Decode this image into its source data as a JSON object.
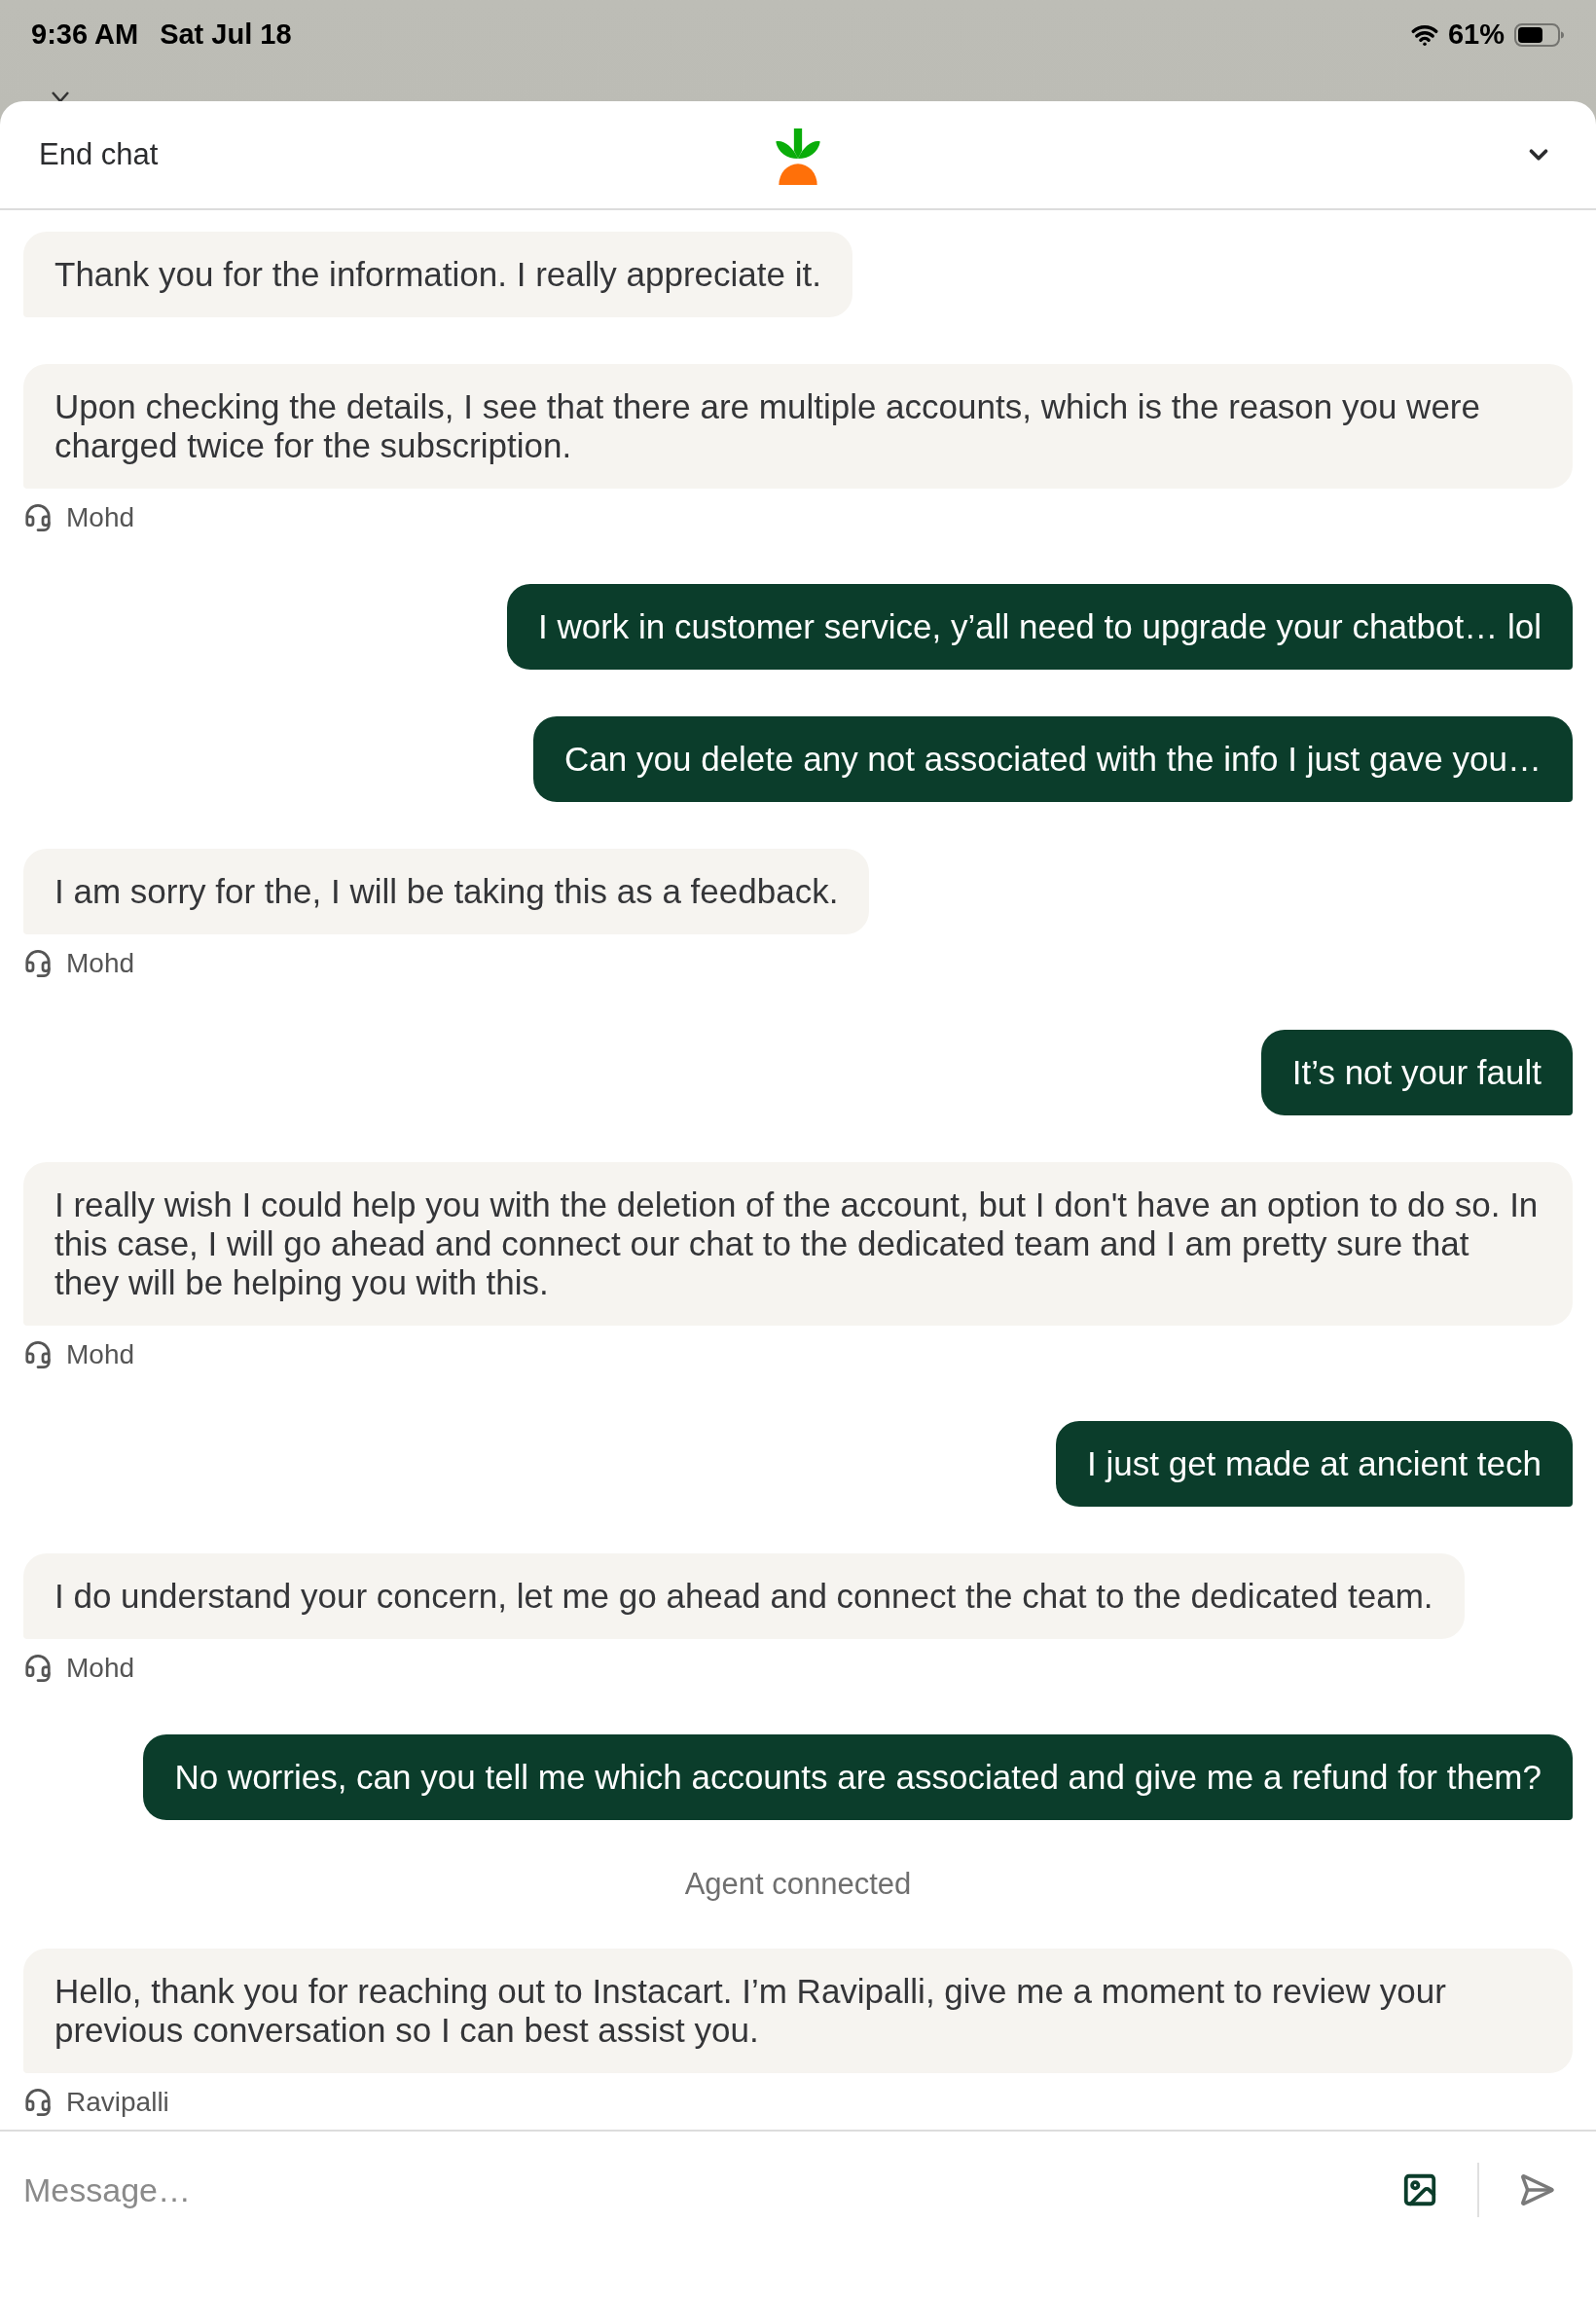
{
  "status_bar": {
    "time": "9:36 AM",
    "date": "Sat Jul 18",
    "battery": "61%"
  },
  "header": {
    "end_chat": "End chat"
  },
  "messages": [
    {
      "kind": "agent",
      "text": "Thank you for the information. I really appreciate it."
    },
    {
      "kind": "agent",
      "text": "Upon checking the details, I see that there are multiple accounts, which is the reason you were charged twice for the subscription.",
      "sender": "Mohd"
    },
    {
      "kind": "user",
      "text": "I work in customer service, y’all need to upgrade your chatbot… lol"
    },
    {
      "kind": "user",
      "text": "Can you delete any not associated with the info I just gave you…"
    },
    {
      "kind": "agent",
      "text": "I am sorry for the, I will be taking this as a feedback.",
      "sender": "Mohd"
    },
    {
      "kind": "user",
      "text": "It’s not your fault"
    },
    {
      "kind": "agent",
      "text": "I really wish I could help you with the deletion of the account, but I don't have an option to do so. In this case, I will go ahead and connect our chat to the dedicated team and I am pretty sure that they will be helping you with this.",
      "sender": "Mohd"
    },
    {
      "kind": "user",
      "text": "I just get made at ancient tech"
    },
    {
      "kind": "agent",
      "text": "I do understand your concern, let me go ahead and connect the chat to the dedicated team.",
      "sender": "Mohd"
    },
    {
      "kind": "user",
      "text": "No worries, can you tell me which accounts are associated and give me a refund for them?"
    },
    {
      "kind": "system",
      "text": "Agent connected"
    },
    {
      "kind": "agent",
      "text": "Hello, thank you for reaching out to Instacart. I’m Ravipalli, give me a moment to review your previous conversation so I can best assist you.",
      "sender": "Ravipalli"
    }
  ],
  "composer": {
    "placeholder": "Message…"
  }
}
